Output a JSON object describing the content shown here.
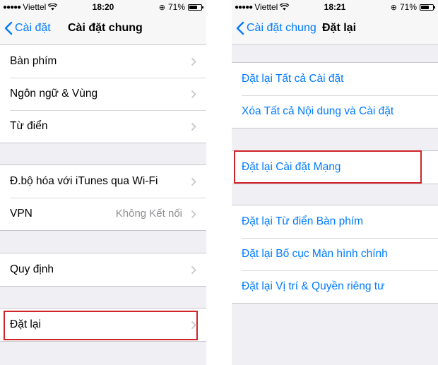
{
  "colors": {
    "accent": "#007aff",
    "highlight": "#d0232a",
    "background": "#efeff4"
  },
  "left": {
    "status": {
      "carrier": "Viettel",
      "time": "18:20",
      "battery": "71%",
      "battery_level": 0.71
    },
    "nav": {
      "back_label": "Cài đặt",
      "title": "Cài đặt chung"
    },
    "groups": [
      {
        "rows": [
          {
            "label": "Bàn phím"
          },
          {
            "label": "Ngôn ngữ & Vùng"
          },
          {
            "label": "Từ điển"
          }
        ]
      },
      {
        "rows": [
          {
            "label": "Đ.bộ hóa với iTunes qua Wi-Fi"
          },
          {
            "label": "VPN",
            "value": "Không Kết nối"
          }
        ]
      },
      {
        "rows": [
          {
            "label": "Quy định"
          }
        ]
      },
      {
        "rows": [
          {
            "label": "Đặt lại"
          }
        ]
      }
    ]
  },
  "right": {
    "status": {
      "carrier": "Viettel",
      "time": "18:21",
      "battery": "71%",
      "battery_level": 0.71
    },
    "nav": {
      "back_label": "Cài đặt chung",
      "title": "Đặt lại"
    },
    "groups": [
      {
        "rows": [
          {
            "label": "Đặt lại Tất cả Cài đặt"
          },
          {
            "label": "Xóa Tất cả Nội dung và Cài đặt"
          }
        ]
      },
      {
        "rows": [
          {
            "label": "Đặt lại Cài đặt Mạng"
          }
        ]
      },
      {
        "rows": [
          {
            "label": "Đặt lại Từ điển Bàn phím"
          },
          {
            "label": "Đặt lại Bố cục Màn hình chính"
          },
          {
            "label": "Đặt lại Vị trí & Quyền riêng tư"
          }
        ]
      }
    ]
  }
}
